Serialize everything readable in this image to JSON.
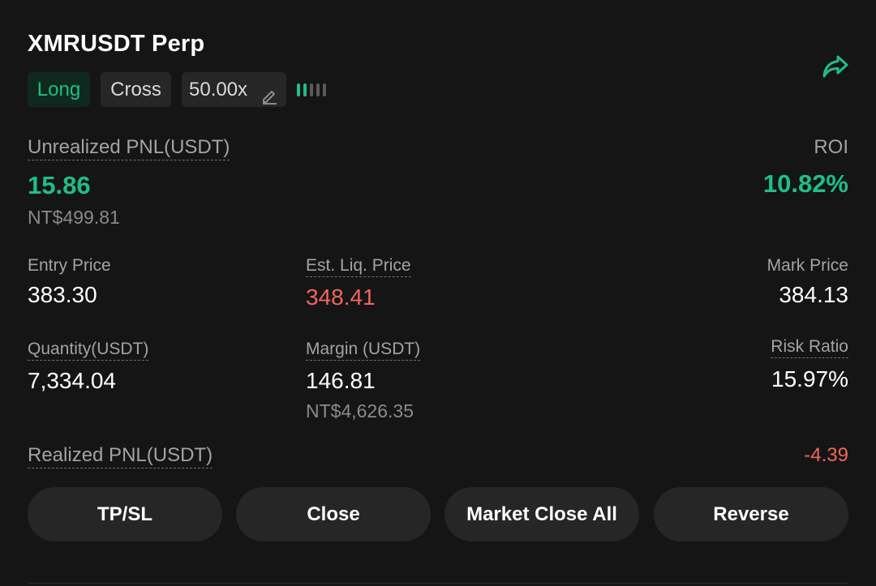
{
  "header": {
    "symbol": "XMRUSDT Perp",
    "side": "Long",
    "margin_mode": "Cross",
    "leverage": "50.00x",
    "risk_bars": {
      "total": 5,
      "filled": 2
    },
    "share_icon": "share-arrow-icon",
    "edit_icon": "pencil-icon"
  },
  "pnl": {
    "unrealized_label": "Unrealized PNL(USDT)",
    "unrealized_value": "15.86",
    "unrealized_fiat": "NT$499.81",
    "roi_label": "ROI",
    "roi_value": "10.82%"
  },
  "stats": {
    "entry_price_label": "Entry Price",
    "entry_price": "383.30",
    "liq_price_label": "Est. Liq. Price",
    "liq_price": "348.41",
    "mark_price_label": "Mark Price",
    "mark_price": "384.13",
    "quantity_label": "Quantity(USDT)",
    "quantity": "7,334.04",
    "margin_label": "Margin (USDT)",
    "margin": "146.81",
    "margin_fiat": "NT$4,626.35",
    "risk_ratio_label": "Risk Ratio",
    "risk_ratio": "15.97%",
    "realized_label": "Realized PNL(USDT)",
    "realized_value": "-4.39"
  },
  "actions": {
    "tpsl": "TP/SL",
    "close": "Close",
    "market_close_all": "Market Close All",
    "reverse": "Reverse"
  },
  "colors": {
    "background": "#151515",
    "positive": "#1fbe87",
    "negative": "#f0675c",
    "chip": "#262626"
  }
}
